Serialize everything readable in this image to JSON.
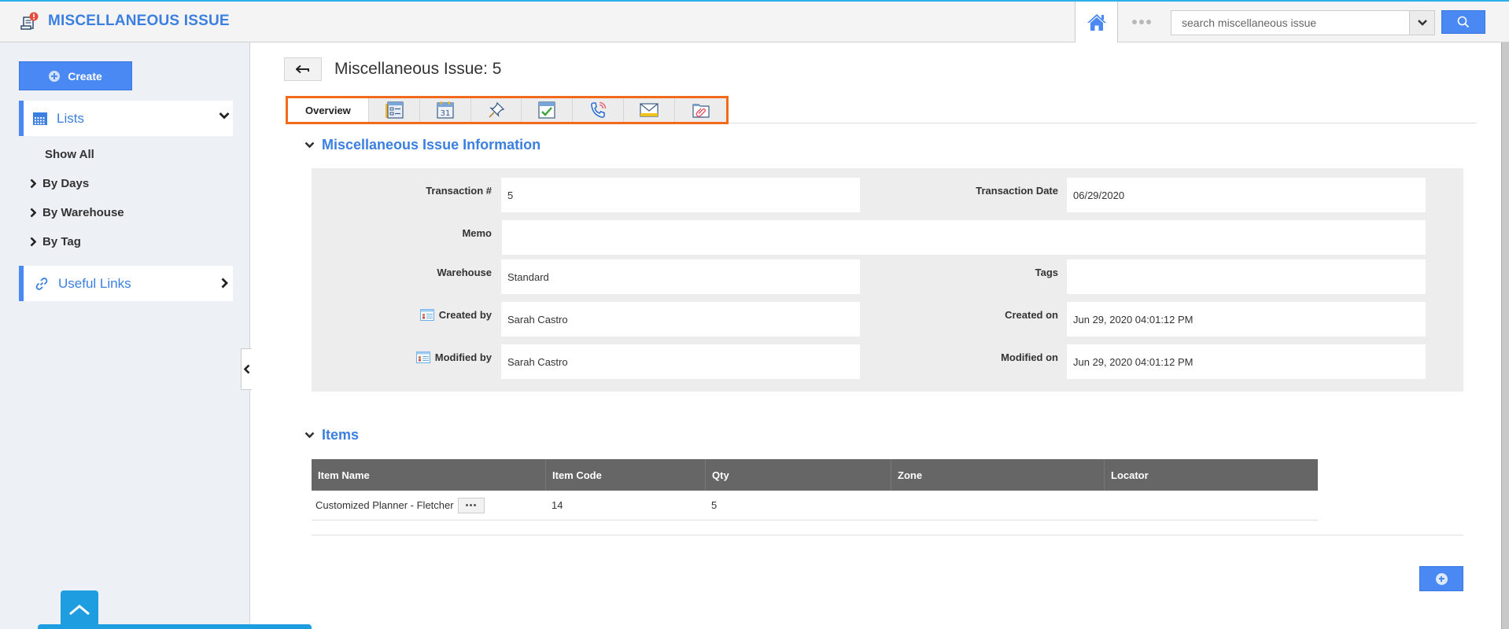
{
  "header": {
    "app_title": "MISCELLANEOUS ISSUE",
    "search": {
      "placeholder": "search miscellaneous issue",
      "value": ""
    },
    "accent_color": "#3b7fe0",
    "top_border_color": "#2bb0ea"
  },
  "sidebar": {
    "create_label": "Create",
    "lists_label": "Lists",
    "list_items": [
      {
        "label": "Show All",
        "has_arrow": false
      },
      {
        "label": "By Days",
        "has_arrow": true
      },
      {
        "label": "By Warehouse",
        "has_arrow": true
      },
      {
        "label": "By Tag",
        "has_arrow": true
      }
    ],
    "useful_links_label": "Useful Links"
  },
  "page": {
    "title": "Miscellaneous Issue: 5",
    "tabs": [
      {
        "label": "Overview",
        "icon": null,
        "active": true
      },
      {
        "label": "",
        "icon": "details-icon"
      },
      {
        "label": "",
        "icon": "calendar-icon",
        "icon_text": "31"
      },
      {
        "label": "",
        "icon": "pin-icon"
      },
      {
        "label": "",
        "icon": "task-icon"
      },
      {
        "label": "",
        "icon": "phone-call-icon"
      },
      {
        "label": "",
        "icon": "email-icon"
      },
      {
        "label": "",
        "icon": "attachment-folder-icon"
      }
    ],
    "highlight_color": "#f26a1b"
  },
  "info_section": {
    "title": "Miscellaneous Issue Information",
    "fields": {
      "transaction_no": {
        "label": "Transaction #",
        "value": "5"
      },
      "transaction_date": {
        "label": "Transaction Date",
        "value": "06/29/2020"
      },
      "memo": {
        "label": "Memo",
        "value": ""
      },
      "warehouse": {
        "label": "Warehouse",
        "value": "Standard"
      },
      "tags": {
        "label": "Tags",
        "value": ""
      },
      "created_by": {
        "label": "Created by",
        "value": "Sarah Castro"
      },
      "created_on": {
        "label": "Created on",
        "value": "Jun 29, 2020 04:01:12 PM"
      },
      "modified_by": {
        "label": "Modified by",
        "value": "Sarah Castro"
      },
      "modified_on": {
        "label": "Modified on",
        "value": "Jun 29, 2020 04:01:12 PM"
      }
    }
  },
  "items_section": {
    "title": "Items",
    "columns": [
      "Item Name",
      "Item Code",
      "Qty",
      "Zone",
      "Locator"
    ],
    "rows": [
      {
        "item_name": "Customized Planner - Fletcher",
        "item_code": "14",
        "qty": "5",
        "zone": "",
        "locator": ""
      }
    ]
  }
}
